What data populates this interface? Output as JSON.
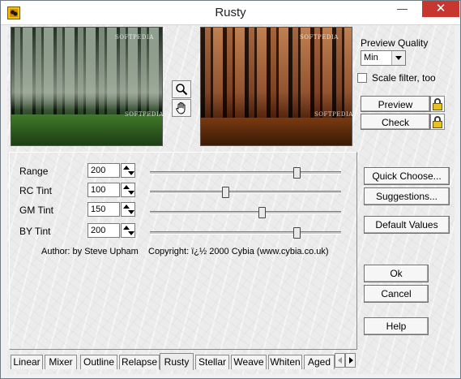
{
  "window": {
    "title": "Rusty",
    "minimize_label": "—",
    "maximize_label": "☐",
    "close_label": "✕"
  },
  "preview_images": {
    "before_watermark_top": "SOFTPEDIA",
    "before_watermark_bottom": "SOFTPEDIA",
    "after_watermark_top": "SOFTPEDIA",
    "after_watermark_bottom": "SOFTPEDIA"
  },
  "tools": {
    "zoom_icon": "magnifier-icon",
    "pan_icon": "hand-icon"
  },
  "preview_quality": {
    "label": "Preview Quality",
    "selected": "Min",
    "scale_filter_label": "Scale filter, too",
    "scale_filter_checked": false
  },
  "buttons": {
    "preview": "Preview",
    "check": "Check",
    "quick_choose": "Quick Choose...",
    "suggestions": "Suggestions...",
    "default_values": "Default Values",
    "ok": "Ok",
    "cancel": "Cancel",
    "help": "Help"
  },
  "params": [
    {
      "label": "Range",
      "value": "200",
      "level": 0.78
    },
    {
      "label": "RC Tint",
      "value": "100",
      "level": 0.39
    },
    {
      "label": "GM Tint",
      "value": "150",
      "level": 0.59
    },
    {
      "label": "BY Tint",
      "value": "200",
      "level": 0.78
    }
  ],
  "credits": {
    "author": "Author: by Steve Upham",
    "copyright": "Copyright: ï¿½ 2000 Cybia (www.cybia.co.uk)"
  },
  "tabs": [
    "Linear",
    "Mixer",
    "Outline",
    "Relapse",
    "Rusty",
    "Stellar",
    "Weave",
    "Whiten",
    "Aged"
  ],
  "active_tab": "Rusty"
}
